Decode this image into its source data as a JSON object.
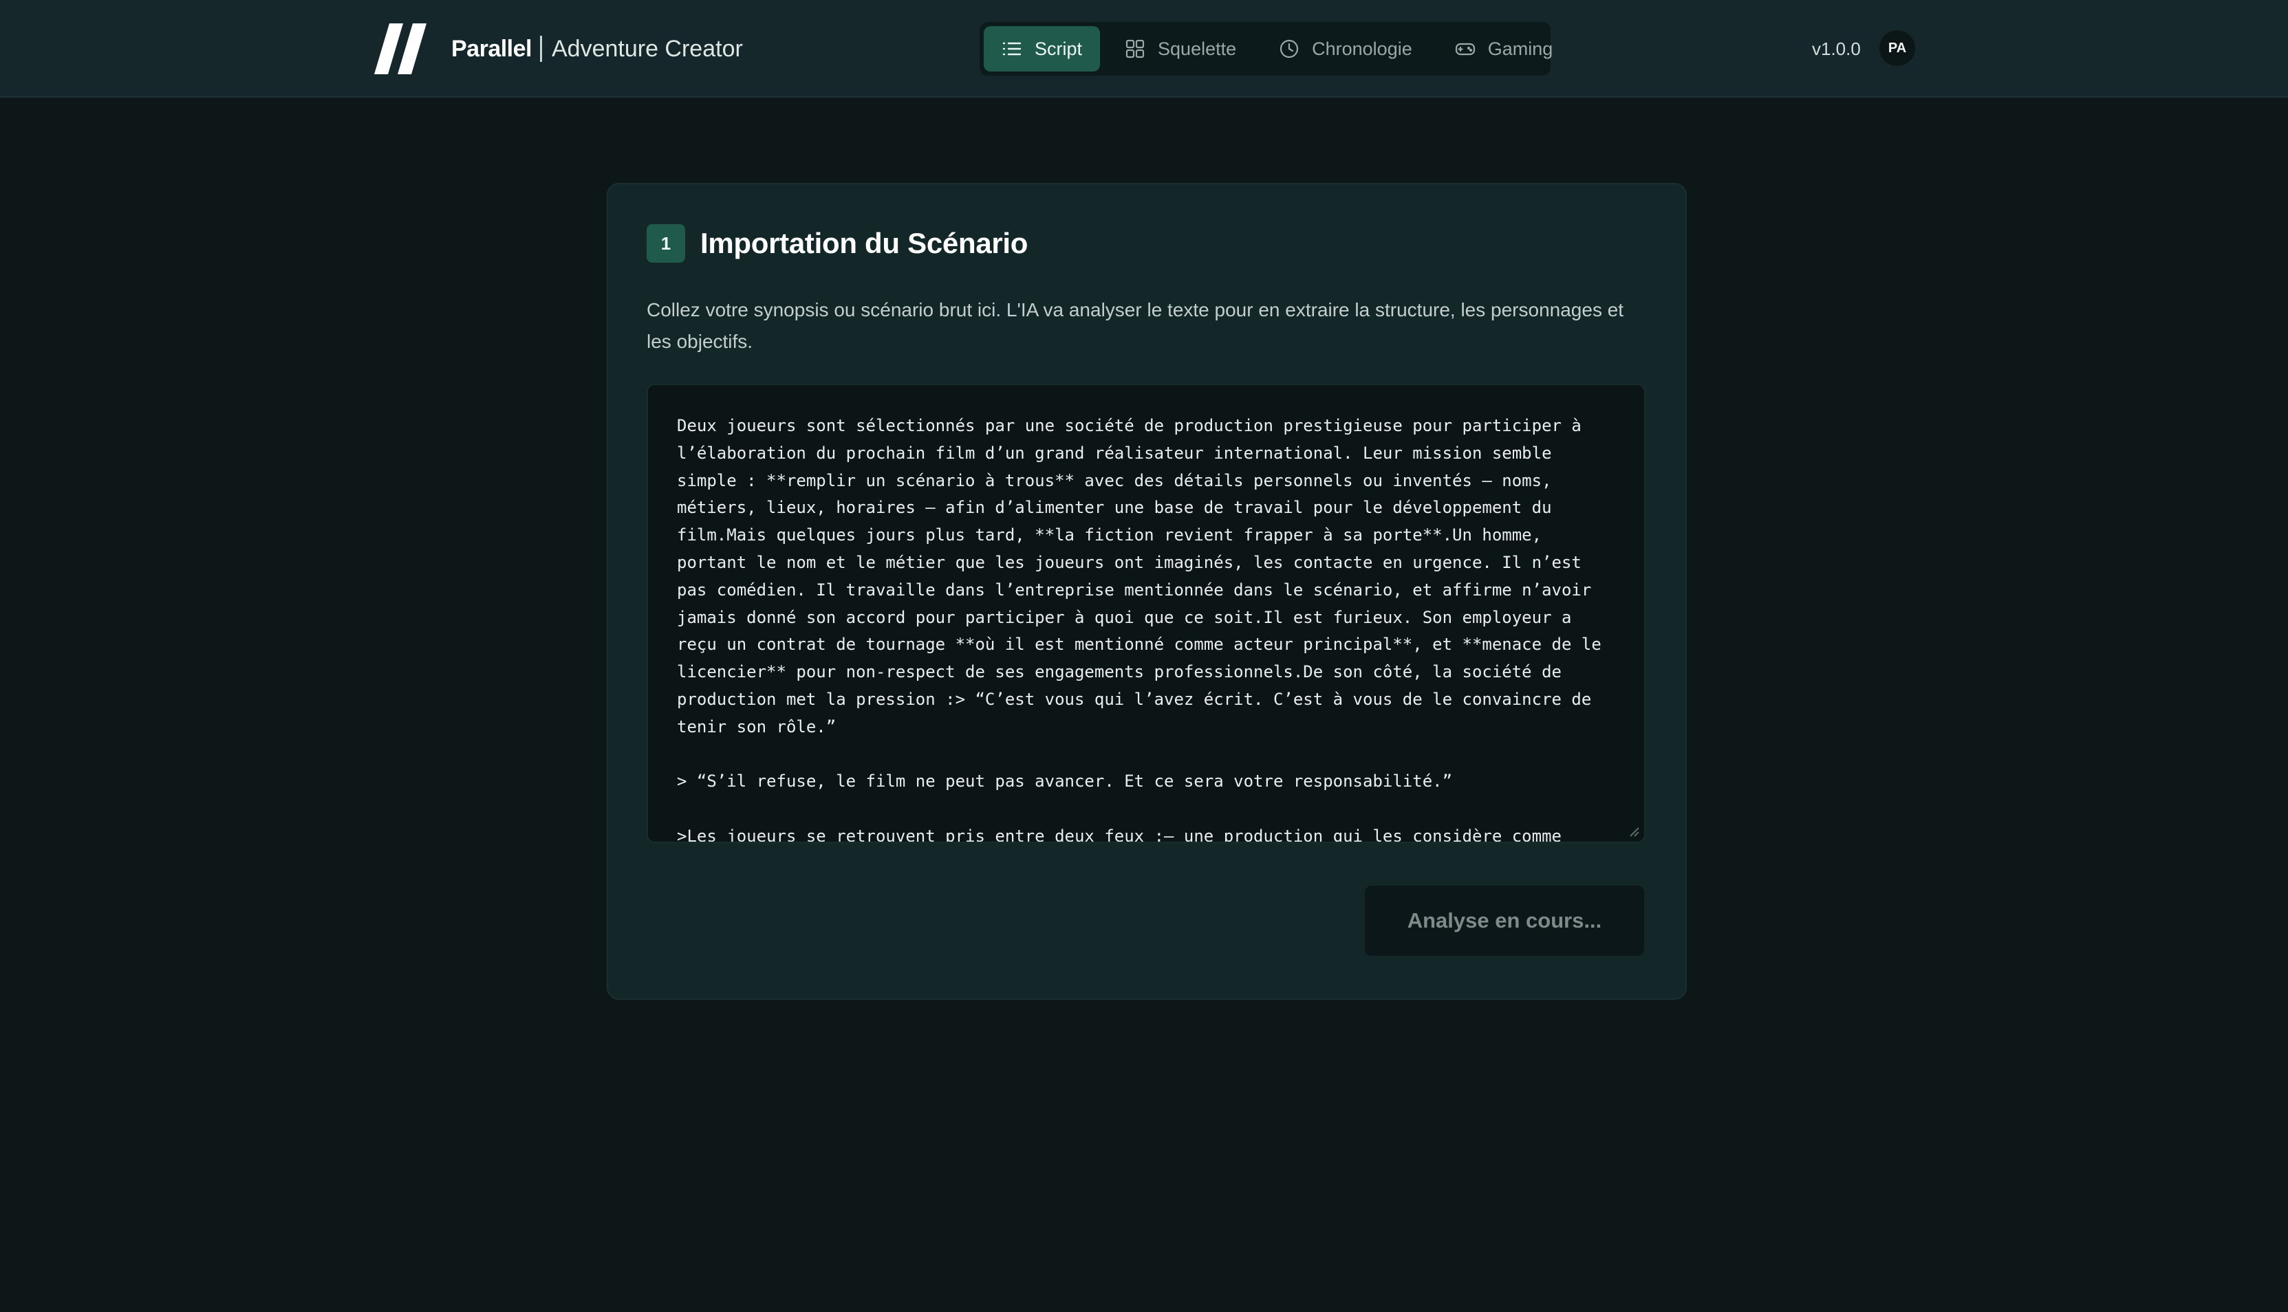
{
  "header": {
    "logo_icon": "double-slash-logo",
    "brand_name": "Parallel",
    "brand_sub": "Adventure Creator",
    "version": "v1.0.0",
    "avatar_initials": "PA",
    "tabs": [
      {
        "label": "Script",
        "icon": "list-icon",
        "active": true
      },
      {
        "label": "Squelette",
        "icon": "grid-icon",
        "active": false
      },
      {
        "label": "Chronologie",
        "icon": "clock-icon",
        "active": false
      },
      {
        "label": "Gaming",
        "icon": "gamepad-icon",
        "active": false
      }
    ]
  },
  "colors": {
    "accent": "#1f5a4c",
    "background": "#0e1718",
    "card": "#132628"
  },
  "card": {
    "step_number": "1",
    "title": "Importation du Scénario",
    "description": "Collez votre synopsis ou scénario brut ici. L'IA va analyser le texte pour en extraire la structure, les personnages et les objectifs.",
    "scenario_text": "Deux joueurs sont sélectionnés par une société de production prestigieuse pour participer à l’élaboration du prochain film d’un grand réalisateur international. Leur mission semble simple : **remplir un scénario à trous** avec des détails personnels ou inventés — noms, métiers, lieux, horaires — afin d’alimenter une base de travail pour le développement du film.Mais quelques jours plus tard, **la fiction revient frapper à sa porte**.Un homme, portant le nom et le métier que les joueurs ont imaginés, les contacte en urgence. Il n’est pas comédien. Il travaille dans l’entreprise mentionnée dans le scénario, et affirme n’avoir jamais donné son accord pour participer à quoi que ce soit.Il est furieux. Son employeur a reçu un contrat de tournage **où il est mentionné comme acteur principal**, et **menace de le licencier** pour non-respect de ses engagements professionnels.De son côté, la société de production met la pression :> “C’est vous qui l’avez écrit. C’est à vous de le convaincre de tenir son rôle.”\n\n> “S’il refuse, le film ne peut pas avancer. Et ce sera votre responsabilité.”\n\n>Les joueurs se retrouvent pris entre deux feux :— une production qui les considère comme",
    "analyze_button_label": "Analyse en cours..."
  }
}
